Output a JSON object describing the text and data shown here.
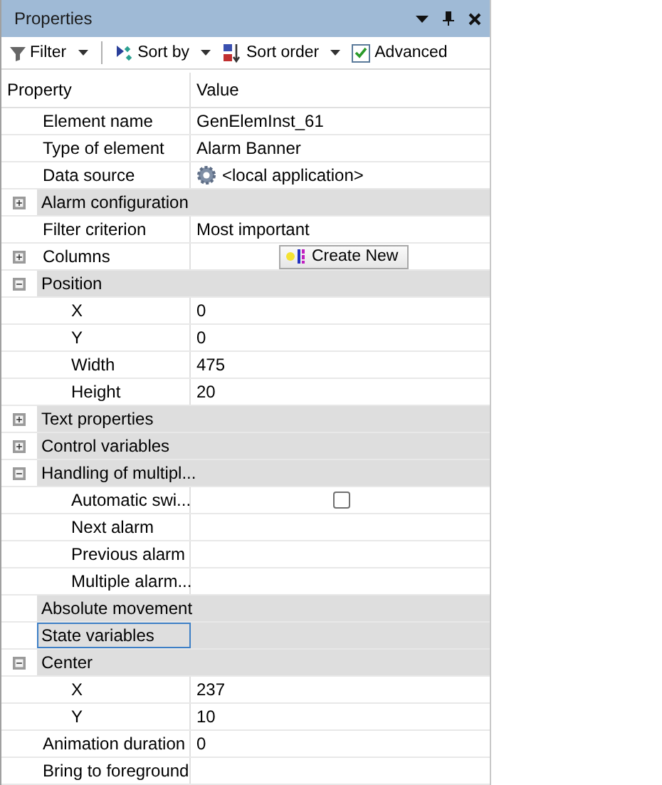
{
  "window": {
    "title": "Properties"
  },
  "toolbar": [
    {
      "kind": "filter",
      "label": "Filter"
    },
    {
      "kind": "sort-by",
      "label": "Sort by"
    },
    {
      "kind": "sort-order",
      "label": "Sort order"
    },
    {
      "kind": "checkbox",
      "label": "Advanced",
      "checked": true
    }
  ],
  "columns": [
    "Property",
    "Value"
  ],
  "rows": [
    {
      "kind": "property",
      "name": "Element name",
      "selected": false,
      "value": {
        "kind": "text",
        "text": "GenElemInst_61"
      }
    },
    {
      "kind": "property",
      "name": "Type of element",
      "selected": false,
      "value": {
        "kind": "text",
        "text": "Alarm Banner"
      }
    },
    {
      "kind": "property",
      "name": "Data source",
      "selected": false,
      "value": {
        "kind": "source",
        "text": "<local application>"
      }
    },
    {
      "kind": "category",
      "name": "Alarm configuration",
      "selected": false,
      "expanded": false
    },
    {
      "kind": "property",
      "name": "Filter criterion",
      "selected": false,
      "value": {
        "kind": "text",
        "text": "Most important"
      }
    },
    {
      "kind": "property",
      "name": "Columns",
      "selected": false,
      "expanded": false,
      "value": {
        "kind": "button",
        "text": "Create New"
      }
    },
    {
      "kind": "category",
      "name": "Position",
      "selected": false,
      "expanded": true,
      "children": [
        {
          "kind": "property",
          "name": "X",
          "selected": false,
          "value": {
            "kind": "text",
            "text": "0"
          }
        },
        {
          "kind": "property",
          "name": "Y",
          "selected": false,
          "value": {
            "kind": "text",
            "text": "0"
          }
        },
        {
          "kind": "property",
          "name": "Width",
          "selected": false,
          "value": {
            "kind": "text",
            "text": "475"
          }
        },
        {
          "kind": "property",
          "name": "Height",
          "selected": false,
          "value": {
            "kind": "text",
            "text": "20"
          }
        }
      ]
    },
    {
      "kind": "category",
      "name": "Text properties",
      "selected": false,
      "expanded": false
    },
    {
      "kind": "category",
      "name": "Control variables",
      "selected": false,
      "expanded": false
    },
    {
      "kind": "category",
      "name": "Handling of multipl...",
      "selected": false,
      "expanded": true,
      "children": [
        {
          "kind": "property",
          "name": "Automatic swi...",
          "selected": false,
          "value": {
            "kind": "checkbox",
            "checked": false
          }
        },
        {
          "kind": "property",
          "name": "Next alarm",
          "selected": false
        },
        {
          "kind": "property",
          "name": "Previous alarm",
          "selected": false
        },
        {
          "kind": "property",
          "name": "Multiple alarm...",
          "selected": false
        }
      ]
    },
    {
      "kind": "group",
      "name": "Absolute movement",
      "selected": false
    },
    {
      "kind": "group",
      "name": "State variables",
      "selected": true
    },
    {
      "kind": "category",
      "name": "Center",
      "selected": false,
      "expanded": true,
      "children": [
        {
          "kind": "property",
          "name": "X",
          "selected": false,
          "value": {
            "kind": "text",
            "text": "237"
          }
        },
        {
          "kind": "property",
          "name": "Y",
          "selected": false,
          "value": {
            "kind": "text",
            "text": "10"
          }
        }
      ]
    },
    {
      "kind": "property",
      "name": "Animation duration",
      "selected": false,
      "value": {
        "kind": "text",
        "text": "0"
      }
    },
    {
      "kind": "property",
      "name": "Bring to foreground",
      "selected": false
    }
  ]
}
